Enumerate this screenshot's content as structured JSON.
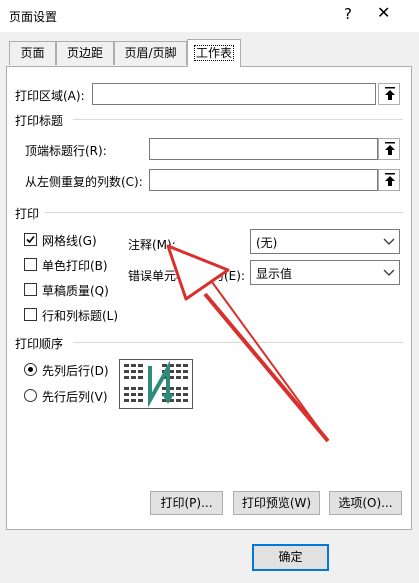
{
  "dialog": {
    "title": "页面设置"
  },
  "tabs": [
    "页面",
    "页边距",
    "页眉/页脚",
    "工作表"
  ],
  "print_area": {
    "label": "打印区域(A):",
    "value": ""
  },
  "print_titles": {
    "group_label": "打印标题",
    "rows_label": "顶端标题行(R):",
    "rows_value": "",
    "cols_label": "从左侧重复的列数(C):",
    "cols_value": ""
  },
  "print": {
    "group_label": "打印",
    "checkboxes": [
      {
        "label": "网格线(G)",
        "checked": true
      },
      {
        "label": "单色打印(B)",
        "checked": false
      },
      {
        "label": "草稿质量(Q)",
        "checked": false
      },
      {
        "label": "行和列标题(L)",
        "checked": false
      }
    ],
    "comments_label": "注释(M):",
    "comments_value": "(无)",
    "errors_label": "错误单元格打印为(E):",
    "errors_value": "显示值"
  },
  "page_order": {
    "group_label": "打印顺序",
    "options": [
      {
        "label": "先列后行(D)",
        "selected": true
      },
      {
        "label": "先行后列(V)",
        "selected": false
      }
    ]
  },
  "buttons": {
    "print": "打印(P)...",
    "preview": "打印预览(W)",
    "options": "选项(O)...",
    "ok": "确定"
  },
  "colors": {
    "annotation_arrow": "#d9302c",
    "accent": "#0078d7",
    "order_arrow": "#2e8b7a"
  }
}
